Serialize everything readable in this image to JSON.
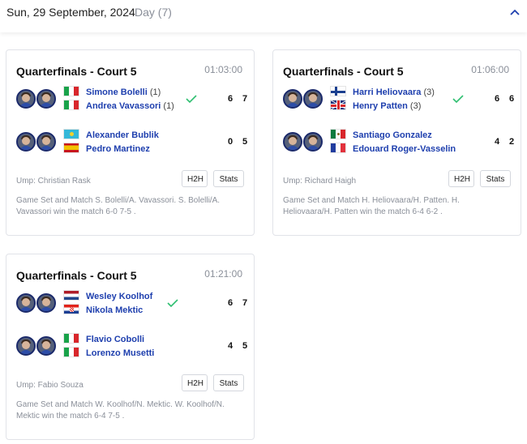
{
  "header": {
    "date": "Sun, 29 September, 2024",
    "day": "Day (7)"
  },
  "matches": [
    {
      "title": "Quarterfinals - Court 5",
      "time": "01:03:00",
      "teams": [
        {
          "players": [
            {
              "name": "Simone Bolelli",
              "seed": "(1)",
              "flag": "IT"
            },
            {
              "name": "Andrea Vavassori",
              "seed": "(1)",
              "flag": "IT"
            }
          ],
          "winner": true,
          "scores": [
            "6",
            "7"
          ]
        },
        {
          "players": [
            {
              "name": "Alexander Bublik",
              "seed": "",
              "flag": "KZ"
            },
            {
              "name": "Pedro Martinez",
              "seed": "",
              "flag": "ES"
            }
          ],
          "winner": false,
          "scores": [
            "0",
            "5"
          ]
        }
      ],
      "umpire": "Ump: Christian Rask",
      "h2h_label": "H2H",
      "stats_label": "Stats",
      "summary": "Game Set and Match S. Bolelli/A. Vavassori. S. Bolelli/A. Vavassori win the match 6-0 7-5 ."
    },
    {
      "title": "Quarterfinals - Court 5",
      "time": "01:06:00",
      "teams": [
        {
          "players": [
            {
              "name": "Harri Heliovaara",
              "seed": "(3)",
              "flag": "FI"
            },
            {
              "name": "Henry Patten",
              "seed": "(3)",
              "flag": "GB"
            }
          ],
          "winner": true,
          "scores": [
            "6",
            "6"
          ]
        },
        {
          "players": [
            {
              "name": "Santiago Gonzalez",
              "seed": "",
              "flag": "MX"
            },
            {
              "name": "Edouard Roger-Vasselin",
              "seed": "",
              "flag": "FR"
            }
          ],
          "winner": false,
          "scores": [
            "4",
            "2"
          ]
        }
      ],
      "umpire": "Ump: Richard Haigh",
      "h2h_label": "H2H",
      "stats_label": "Stats",
      "summary": "Game Set and Match H. Heliovaara/H. Patten. H. Heliovaara/H. Patten win the match 6-4 6-2 ."
    },
    {
      "title": "Quarterfinals - Court 5",
      "time": "01:21:00",
      "teams": [
        {
          "players": [
            {
              "name": "Wesley Koolhof",
              "seed": "",
              "flag": "NL"
            },
            {
              "name": "Nikola Mektic",
              "seed": "",
              "flag": "HR"
            }
          ],
          "winner": true,
          "scores": [
            "6",
            "7"
          ]
        },
        {
          "players": [
            {
              "name": "Flavio Cobolli",
              "seed": "",
              "flag": "IT"
            },
            {
              "name": "Lorenzo Musetti",
              "seed": "",
              "flag": "IT"
            }
          ],
          "winner": false,
          "scores": [
            "4",
            "5"
          ]
        }
      ],
      "umpire": "Ump: Fabio Souza",
      "h2h_label": "H2H",
      "stats_label": "Stats",
      "summary": "Game Set and Match W. Koolhof/N. Mektic. W. Koolhof/N. Mektic win the match 6-4 7-5 ."
    }
  ],
  "colors": {
    "player_link": "#1e3fae",
    "winner_check": "#2fbf71",
    "accent": "#1e3fae"
  },
  "icons": {
    "collapse": "chevron-up-icon",
    "winner": "check-icon"
  }
}
